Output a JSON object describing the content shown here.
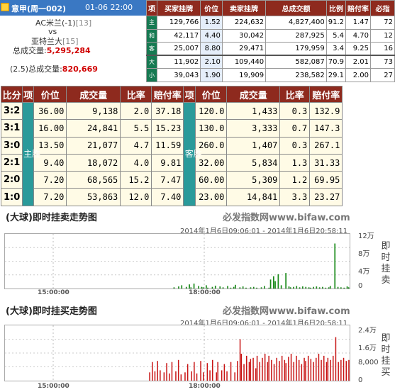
{
  "header": {
    "league": "意甲(周一002)",
    "datetime": "01-06 22:00",
    "home_team": "AC米兰(-1)",
    "home_rank": "[13]",
    "vs": "vs",
    "away_team": "亚特兰大",
    "away_rank": "[15]",
    "total_volume_label": "总成交量:",
    "total_volume": "5,295,284",
    "ou_label": "(2.5)总成交量:",
    "ou_volume": "820,669"
  },
  "top_table": {
    "headers": [
      "项",
      "买家挂牌",
      "价位",
      "卖家挂牌",
      "总成交额",
      "比例",
      "赔付率",
      "必指"
    ],
    "rows": [
      {
        "label": "主",
        "buy": "129,766",
        "price": "1.52",
        "sell": "224,632",
        "total": "4,827,400",
        "ratio": "91.2",
        "payout": "1.47",
        "idx": "72"
      },
      {
        "label": "和",
        "buy": "42,117",
        "price": "4.40",
        "sell": "30,042",
        "total": "287,925",
        "ratio": "5.4",
        "payout": "4.70",
        "idx": "12"
      },
      {
        "label": "客",
        "buy": "25,007",
        "price": "8.80",
        "sell": "29,471",
        "total": "179,959",
        "ratio": "3.4",
        "payout": "9.25",
        "idx": "16"
      },
      {
        "label": "大",
        "buy": "11,902",
        "price": "2.10",
        "sell": "109,440",
        "total": "582,087",
        "ratio": "70.9",
        "payout": "2.01",
        "idx": "73"
      },
      {
        "label": "小",
        "buy": "39,043",
        "price": "1.90",
        "sell": "19,909",
        "total": "238,582",
        "ratio": "29.1",
        "payout": "2.00",
        "idx": "27"
      }
    ]
  },
  "score_table": {
    "headers": [
      "比分",
      "项",
      "价位",
      "成交量",
      "比率",
      "赔付率",
      "项",
      "价位",
      "成交量",
      "比率",
      "赔付率"
    ],
    "home_side": "主胜",
    "away_side": "客胜",
    "rows": [
      {
        "score": "3:2",
        "hp": "36.00",
        "hv": "9,138",
        "hr": "2.0",
        "hpay": "37.18",
        "ap": "120.0",
        "av": "1,433",
        "ar": "0.3",
        "apay": "132.9"
      },
      {
        "score": "3:1",
        "hp": "16.00",
        "hv": "24,841",
        "hr": "5.5",
        "hpay": "15.23",
        "ap": "130.0",
        "av": "3,333",
        "ar": "0.7",
        "apay": "147.3"
      },
      {
        "score": "3:0",
        "hp": "13.50",
        "hv": "21,077",
        "hr": "4.7",
        "hpay": "11.59",
        "ap": "260.0",
        "av": "1,407",
        "ar": "0.3",
        "apay": "267.1"
      },
      {
        "score": "2:1",
        "hp": "9.40",
        "hv": "18,072",
        "hr": "4.0",
        "hpay": "9.81",
        "ap": "32.00",
        "av": "5,834",
        "ar": "1.3",
        "apay": "31.33"
      },
      {
        "score": "2:0",
        "hp": "7.20",
        "hv": "68,565",
        "hr": "15.2",
        "hpay": "7.47",
        "ap": "60.00",
        "av": "5,309",
        "ar": "1.2",
        "apay": "69.95"
      },
      {
        "score": "1:0",
        "hp": "7.20",
        "hv": "53,863",
        "hr": "12.0",
        "hpay": "7.40",
        "ap": "23.00",
        "av": "14,841",
        "ar": "3.3",
        "apay": "23.27"
      }
    ]
  },
  "chart_sell": {
    "title": "(大球)即时挂卖走势图",
    "watermark": "必发指数网www.bifaw.com",
    "range": "2014年1月6日09:06:01 - 2014年1月6日20:58:11",
    "side_title": "即时挂卖"
  },
  "chart_buy": {
    "title": "(大球)即时挂买走势图",
    "watermark": "必发指数网www.bifaw.com",
    "range": "2014年1月6日09:06:01 - 2014年1月6日20:58:11",
    "side_title": "即时挂买"
  },
  "chart_data": [
    {
      "type": "bar",
      "title": "(大球)即时挂卖走势图",
      "color": "#1a8a1a",
      "x_ticks": [
        "15:00:00",
        "18:00:00"
      ],
      "y_ticks": [
        "12万",
        "8万",
        "4万",
        "0"
      ],
      "ylim": [
        0,
        130000
      ],
      "values": [
        0,
        0,
        0,
        0,
        0,
        0,
        0,
        0,
        0,
        0,
        0,
        0,
        0,
        0,
        0,
        0,
        0,
        0,
        0,
        0,
        0,
        0,
        0,
        0,
        0,
        0,
        0,
        0,
        0,
        0,
        0,
        0,
        0,
        0,
        0,
        0,
        0,
        0,
        0,
        0,
        0,
        0,
        0,
        0,
        0,
        0,
        0,
        0,
        0,
        0,
        0,
        0,
        0,
        0,
        0,
        0,
        0,
        0,
        0,
        0,
        0,
        0,
        0,
        0,
        0,
        0,
        0,
        0,
        0,
        0,
        0,
        0,
        0,
        0,
        0,
        0,
        0,
        0,
        0,
        0,
        0,
        0,
        0,
        0,
        0,
        0,
        0,
        0,
        0,
        0,
        0,
        0,
        0,
        0,
        0,
        0,
        0,
        0,
        0,
        0,
        0,
        0,
        0,
        0,
        0,
        0,
        0,
        0,
        0,
        0,
        3000,
        0,
        0,
        5000,
        0,
        8000,
        0,
        0,
        4000,
        0,
        10000,
        3000,
        0,
        12000,
        0,
        0,
        6000,
        0,
        4000,
        3000,
        0,
        8000,
        2000,
        0,
        0,
        4000,
        0,
        7000,
        0,
        0,
        5000,
        0,
        3000,
        0,
        0,
        6000,
        0,
        2000,
        0,
        4000,
        9000,
        0,
        0,
        3000,
        0,
        5000,
        0,
        2000,
        0,
        0,
        3000,
        0,
        4000,
        0,
        2000,
        0,
        0,
        3000,
        0,
        6000,
        0,
        0,
        2000,
        22000,
        0,
        30000,
        18000,
        0,
        35000,
        0,
        8000,
        0,
        0,
        38000,
        0,
        5000,
        3000,
        0,
        4000,
        0,
        6000,
        0,
        3000,
        0,
        5000,
        0,
        4000,
        0,
        3000,
        2000,
        0,
        4000,
        0,
        5000,
        0,
        3000,
        0,
        4000,
        0,
        2000,
        0,
        3000,
        6000,
        0,
        0,
        110000,
        0,
        4000,
        0,
        3000,
        0,
        2000,
        0,
        5000,
        3000
      ]
    },
    {
      "type": "bar",
      "title": "(大球)即时挂买走势图",
      "color": "#c81414",
      "x_ticks": [
        "15:00:00",
        "18:00:00"
      ],
      "y_ticks": [
        "2.4万",
        "1.6万",
        "8,000",
        "0"
      ],
      "ylim": [
        0,
        26000
      ],
      "values": [
        0,
        0,
        0,
        0,
        0,
        0,
        0,
        0,
        0,
        0,
        0,
        0,
        0,
        0,
        0,
        0,
        0,
        0,
        0,
        0,
        0,
        0,
        0,
        0,
        0,
        0,
        0,
        0,
        0,
        0,
        0,
        0,
        0,
        0,
        0,
        0,
        0,
        0,
        0,
        0,
        0,
        0,
        0,
        0,
        0,
        0,
        0,
        0,
        0,
        0,
        0,
        0,
        0,
        0,
        0,
        0,
        0,
        0,
        0,
        0,
        0,
        0,
        0,
        0,
        0,
        0,
        0,
        0,
        0,
        0,
        0,
        0,
        0,
        0,
        0,
        0,
        0,
        0,
        0,
        0,
        0,
        0,
        0,
        0,
        0,
        0,
        0,
        0,
        0,
        0,
        0,
        0,
        0,
        0,
        0,
        0,
        0,
        0,
        0,
        0,
        0,
        0,
        0,
        0,
        0,
        0,
        0,
        0,
        0,
        0,
        4000,
        0,
        9000,
        0,
        4500,
        0,
        9500,
        0,
        5000,
        0,
        0,
        4000,
        0,
        8500,
        0,
        3500,
        0,
        9000,
        0,
        0,
        4500,
        0,
        10000,
        0,
        3000,
        0,
        0,
        4000,
        0,
        8000,
        0,
        0,
        4500,
        0,
        9000,
        0,
        3500,
        0,
        0,
        9500,
        0,
        4000,
        0,
        0,
        8500,
        0,
        5000,
        0,
        10000,
        0,
        0,
        4000,
        9000,
        0,
        0,
        5000,
        0,
        8000,
        0,
        4500,
        0,
        0,
        9000,
        0,
        0,
        4000,
        0,
        9500,
        0,
        20000,
        13000,
        0,
        8000,
        0,
        12000,
        0,
        9000,
        10500,
        0,
        11000,
        0,
        6000,
        12000,
        0,
        9000,
        0,
        11000,
        0,
        13000,
        0,
        9000,
        12000,
        0,
        10000,
        0,
        8000,
        0,
        11000,
        0,
        9500,
        0,
        12000,
        0,
        10000,
        8500,
        0,
        11500,
        0,
        13000,
        0,
        9000,
        0,
        12000,
        0,
        10000,
        0,
        8000,
        0,
        11000,
        9500,
        0,
        12000,
        0,
        10500,
        0,
        9000,
        0,
        11000,
        0,
        13000,
        0,
        10000,
        0,
        12000,
        0,
        9000,
        11000,
        0,
        10000,
        0,
        12000,
        0,
        21000,
        0,
        9000,
        0,
        10000,
        0,
        11000,
        0,
        9500,
        0,
        10000
      ]
    }
  ]
}
